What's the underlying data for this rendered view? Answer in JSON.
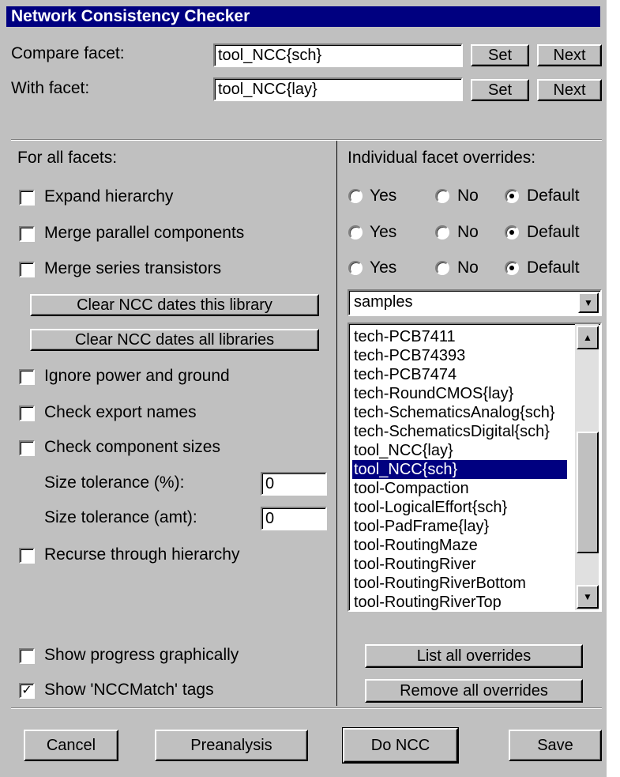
{
  "window": {
    "title": "Network Consistency Checker"
  },
  "facets": {
    "compare_label": "Compare facet:",
    "compare_value": "tool_NCC{sch}",
    "with_label": "With facet:",
    "with_value": "tool_NCC{lay}",
    "set_label": "Set",
    "next_label": "Next"
  },
  "left": {
    "heading": "For all facets:",
    "expand_hierarchy": {
      "label": "Expand hierarchy",
      "checked": false
    },
    "merge_parallel": {
      "label": "Merge parallel components",
      "checked": false
    },
    "merge_series": {
      "label": "Merge series transistors",
      "checked": false
    },
    "clear_library_button": "Clear NCC dates this library",
    "clear_all_button": "Clear NCC dates all libraries",
    "ignore_power": {
      "label": "Ignore power and ground",
      "checked": false
    },
    "check_export": {
      "label": "Check export names",
      "checked": false
    },
    "check_sizes": {
      "label": "Check component sizes",
      "checked": false
    },
    "size_tol_pct_label": "Size tolerance (%):",
    "size_tol_pct_value": "0",
    "size_tol_amt_label": "Size tolerance (amt):",
    "size_tol_amt_value": "0",
    "recurse": {
      "label": "Recurse through hierarchy",
      "checked": false
    },
    "show_progress": {
      "label": "Show progress graphically",
      "checked": false
    },
    "show_tags": {
      "label": "Show 'NCCMatch' tags",
      "checked": true
    }
  },
  "right": {
    "heading": "Individual facet overrides:",
    "radio_labels": {
      "yes": "Yes",
      "no": "No",
      "default": "Default"
    },
    "override_rows": [
      "Default",
      "Default",
      "Default"
    ],
    "library_select": "samples",
    "facet_list": [
      "tech-PCB7411",
      "tech-PCB74393",
      "tech-PCB7474",
      "tech-RoundCMOS{lay}",
      "tech-SchematicsAnalog{sch}",
      "tech-SchematicsDigital{sch}",
      "tool_NCC{lay}",
      "tool_NCC{sch}",
      "tool-Compaction",
      "tool-LogicalEffort{sch}",
      "tool-PadFrame{lay}",
      "tool-RoutingMaze",
      "tool-RoutingRiver",
      "tool-RoutingRiverBottom",
      "tool-RoutingRiverTop"
    ],
    "selected_facet": "tool_NCC{sch}",
    "list_overrides_button": "List all overrides",
    "remove_overrides_button": "Remove all overrides"
  },
  "footer": {
    "cancel": "Cancel",
    "preanalysis": "Preanalysis",
    "do_ncc": "Do NCC",
    "save": "Save"
  },
  "icons": {
    "check": "✓",
    "dropdown_arrow": "▼",
    "scroll_up": "▲",
    "scroll_down": "▼"
  },
  "colors": {
    "face": "#c0c0c0",
    "title_bg": "#000080",
    "selection": "#000080"
  }
}
